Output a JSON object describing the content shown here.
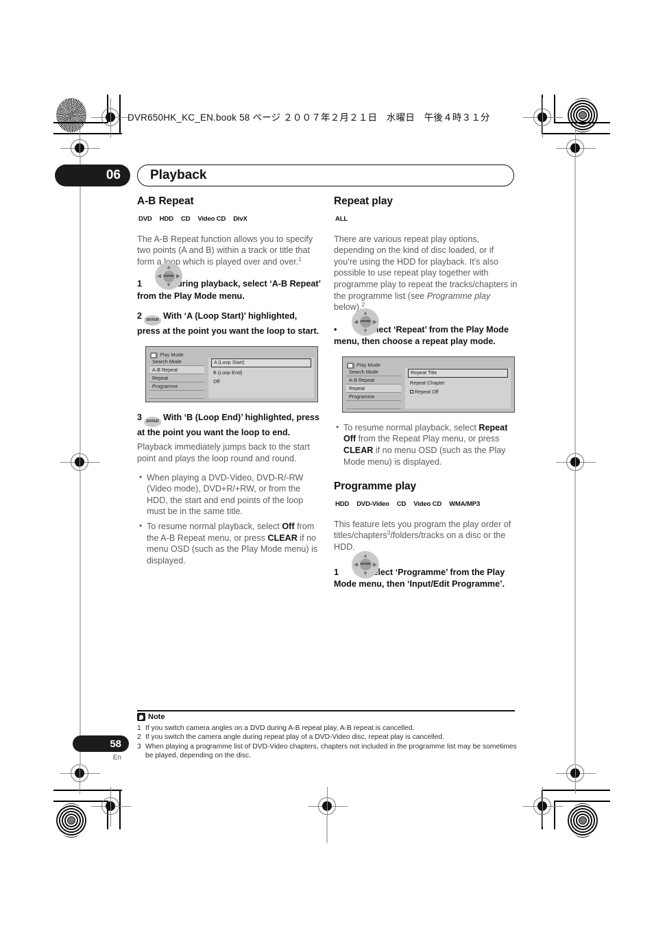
{
  "header": {
    "file_line": "DVR650HK_KC_EN.book  58 ページ  ２００７年２月２１日　水曜日　午後４時３１分"
  },
  "chapter": {
    "number": "06",
    "title": "Playback"
  },
  "page": {
    "number": "58",
    "language": "En"
  },
  "left_column": {
    "section_title": "A-B Repeat",
    "badges": [
      {
        "label": "DVD"
      },
      {
        "label": "HDD"
      },
      {
        "label": "CD"
      },
      {
        "label": "Video CD"
      },
      {
        "label": "DivX"
      }
    ],
    "intro": "The A-B Repeat function allows you to specify two points (A and B) within a track or title that form a loop which is played over and over.",
    "intro_footnote": "1",
    "step1": {
      "num": "1",
      "icon": "dpad-enter-icon",
      "text": "During playback, select ‘A-B Repeat’ from the Play Mode menu."
    },
    "step2": {
      "num": "2",
      "icon": "enter-button-icon",
      "text": "With ‘A (Loop Start)’ highlighted, press at the point you want the loop to start."
    },
    "osd": {
      "title": "Play Mode",
      "menu_items": [
        "Search Mode",
        "A-B Repeat",
        "Repeat",
        "Programme"
      ],
      "selected_menu_item": "A-B Repeat",
      "options": [
        "A (Loop Start)",
        "B (Loop End)",
        "Off"
      ],
      "highlighted_option": "A (Loop Start)"
    },
    "step3": {
      "num": "3",
      "icon": "enter-button-icon",
      "text": "With ‘B (Loop End)’ highlighted, press at the point you want the loop to end."
    },
    "step3_body": "Playback immediately jumps back to the start point and plays the loop round and round.",
    "bullets": [
      {
        "parts": [
          {
            "t": "When playing a DVD-Video, DVD-R/-RW (Video mode), DVD+R/+RW, or from the HDD, the start and end points of the loop must be in the same title.",
            "b": false
          }
        ]
      },
      {
        "parts": [
          {
            "t": "To resume normal playback, select ",
            "b": false
          },
          {
            "t": "Off",
            "b": true
          },
          {
            "t": " from the A-B Repeat menu, or press ",
            "b": false
          },
          {
            "t": "CLEAR",
            "b": true
          },
          {
            "t": " if no menu OSD (such as the Play Mode menu) is displayed.",
            "b": false
          }
        ]
      }
    ]
  },
  "right_column": {
    "section_title": "Repeat play",
    "badges": [
      {
        "label": "ALL"
      }
    ],
    "intro_pre": "There are various repeat play options, depending on the kind of disc loaded, or if you're using the HDD for playback. It's also possible to use repeat play together with programme play to repeat the tracks/chapters in the programme list (see ",
    "intro_italic": "Programme play",
    "intro_post": " below).",
    "intro_footnote": "2",
    "step_bullet": {
      "num": "•",
      "icon": "dpad-enter-icon",
      "text": "Select ‘Repeat’ from the Play Mode menu, then choose a repeat play mode."
    },
    "osd": {
      "title": "Play Mode",
      "menu_items": [
        "Search Mode",
        "A-B Repeat",
        "Repeat",
        "Programme"
      ],
      "selected_menu_item": "Repeat",
      "options": [
        "Repeat Title",
        "Repeat Chapter",
        "Repeat Off"
      ],
      "highlighted_option": "Repeat Title",
      "checkbox_option": "Repeat Off"
    },
    "bullets": [
      {
        "parts": [
          {
            "t": "To resume normal playback, select ",
            "b": false
          },
          {
            "t": "Repeat Off",
            "b": true
          },
          {
            "t": " from the Repeat Play menu, or press ",
            "b": false
          },
          {
            "t": "CLEAR",
            "b": true
          },
          {
            "t": " if no menu OSD (such as the Play Mode menu) is displayed.",
            "b": false
          }
        ]
      }
    ],
    "section_title2": "Programme play",
    "badges2": [
      {
        "label": "HDD"
      },
      {
        "label": "DVD-Video"
      },
      {
        "label": "CD"
      },
      {
        "label": "Video CD"
      },
      {
        "label": "WMA/MP3"
      }
    ],
    "intro2_pre": "This feature lets you program the play order of titles/chapters",
    "intro2_footnote": "3",
    "intro2_post": "/folders/tracks on a disc or the HDD.",
    "step1": {
      "num": "1",
      "icon": "dpad-enter-icon",
      "text": "Select ‘Programme’ from the Play Mode menu, then ‘Input/Edit Programme’."
    }
  },
  "notes": {
    "heading": "Note",
    "items": [
      {
        "idx": "1",
        "text": "If you switch camera angles on a DVD during A-B repeat play, A-B repeat is cancelled."
      },
      {
        "idx": "2",
        "text": "If you switch the camera angle during repeat play of a DVD-Video disc, repeat play is cancelled."
      },
      {
        "idx": "3",
        "text": "When playing a programme list of DVD-Video chapters, chapters not included in the programme list may be sometimes be played, depending on the disc."
      }
    ]
  },
  "icons": {
    "dpad": {
      "enter_label": "ENTER",
      "up": "+",
      "down": "+",
      "left": "+",
      "right": "+"
    },
    "enter_pill": {
      "label": "ENTER"
    }
  }
}
